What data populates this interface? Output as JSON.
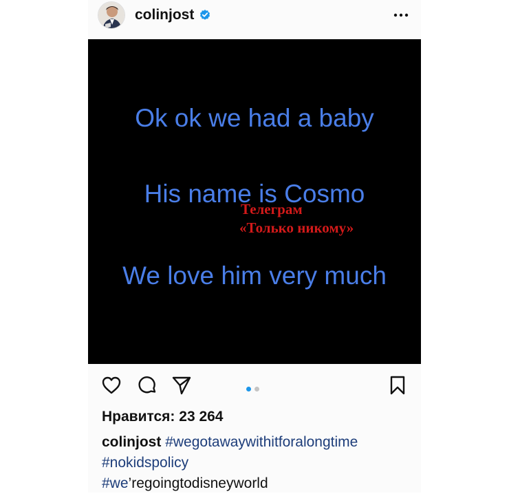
{
  "post": {
    "username": "colinjost",
    "verified_icon": "verified-badge-icon",
    "more_icon": "more-options-icon",
    "media": {
      "background": "#000000",
      "text_color": "#4a7ee8",
      "lines": [
        "Ok ok we had a baby",
        "His name is Cosmo",
        "We love him very much"
      ],
      "watermark": {
        "color": "#d31a1a",
        "line1": "Телеграм",
        "line2": "«Только никому»"
      }
    },
    "actions": {
      "like_icon": "heart-icon",
      "comment_icon": "comment-icon",
      "share_icon": "paper-plane-icon",
      "save_icon": "bookmark-icon",
      "carousel": {
        "count": 2,
        "active_index": 0,
        "active_color": "#1c96ea",
        "inactive_color": "#c4c4c4"
      }
    },
    "likes_text": "Нравится: 23 264",
    "caption": {
      "user": "colinjost",
      "tag1": "#wegotawaywithitforalongtime",
      "tag2": "#nokidspolicy",
      "tag3_hash": "#we",
      "tag3_rest": "’regoingtodisneyworld"
    }
  }
}
